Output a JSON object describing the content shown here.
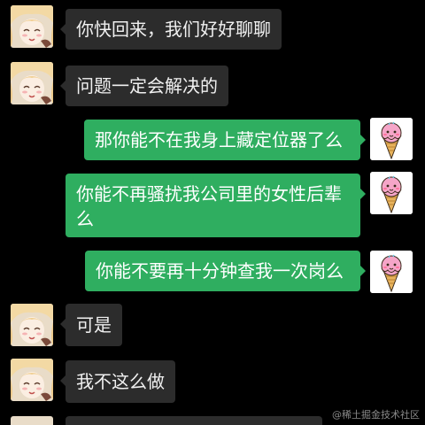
{
  "messages": [
    {
      "side": "in",
      "text": "你快回来，我们好好聊聊",
      "avatar": "anime-girl-avatar"
    },
    {
      "side": "in",
      "text": "问题一定会解决的",
      "avatar": "anime-girl-avatar"
    },
    {
      "side": "out",
      "text": "那你能不在我身上藏定位器了么",
      "avatar": "ice-cream-avatar"
    },
    {
      "side": "out",
      "text": "你能不再骚扰我公司里的女性后辈么",
      "avatar": "ice-cream-avatar"
    },
    {
      "side": "out",
      "text": "你能不要再十分钟查我一次岗么",
      "avatar": "ice-cream-avatar"
    },
    {
      "side": "in",
      "text": "可是",
      "avatar": "anime-girl-avatar"
    },
    {
      "side": "in",
      "text": "我不这么做",
      "avatar": "anime-girl-avatar"
    }
  ],
  "watermark": "@稀土掘金技术社区",
  "colors": {
    "background": "#000000",
    "incoming_bubble": "#2c2c2c",
    "outgoing_bubble": "#2fae60"
  }
}
